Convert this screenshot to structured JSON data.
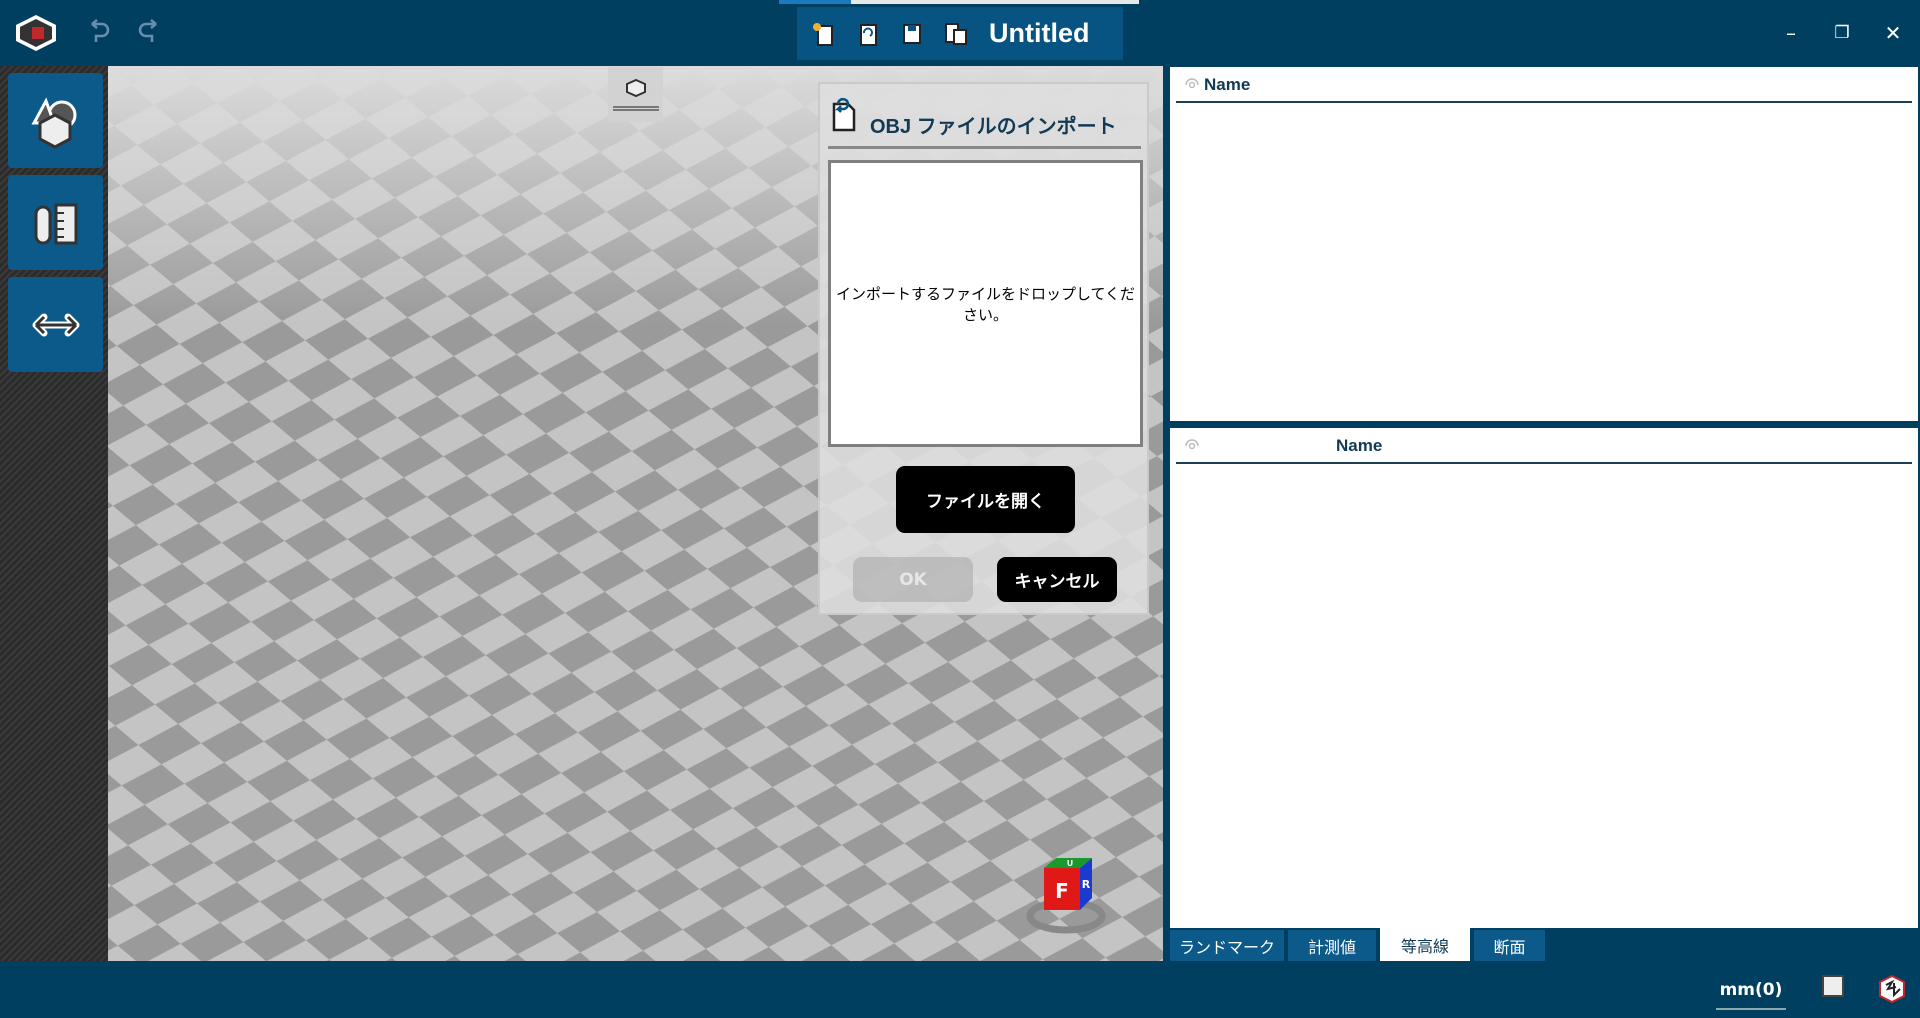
{
  "titlebar": {
    "title": "Untitled",
    "icons": [
      "app-logo-icon",
      "undo-icon",
      "redo-icon",
      "new-file-icon",
      "open-file-icon",
      "save-icon",
      "save-as-icon"
    ],
    "window_controls": {
      "minimize": "–",
      "restore": "❐",
      "close": "✕"
    }
  },
  "toolbar": {
    "items": [
      {
        "name": "shapes-icon"
      },
      {
        "name": "pencil-ruler-icon"
      },
      {
        "name": "measure-arrow-icon"
      }
    ]
  },
  "dialog": {
    "title": "OBJ ファイルのインポート",
    "drop_text": "インポートするファイルをドロップしてください。",
    "open_label": "ファイルを開く",
    "ok_label": "OK",
    "cancel_label": "キャンセル"
  },
  "navcube": {
    "front": "F",
    "right": "R",
    "top": "U"
  },
  "panel": {
    "upper_header": "Name",
    "lower_header": "Name",
    "tabs": [
      {
        "label": "ランドマーク",
        "active": false
      },
      {
        "label": "計測値",
        "active": false
      },
      {
        "label": "等高線",
        "active": true
      },
      {
        "label": "断面",
        "active": false
      }
    ]
  },
  "status": {
    "units": "mm(0)"
  },
  "colors": {
    "chrome": "#003f60",
    "accent": "#0b5a8a",
    "dialog_button": "#000000"
  }
}
